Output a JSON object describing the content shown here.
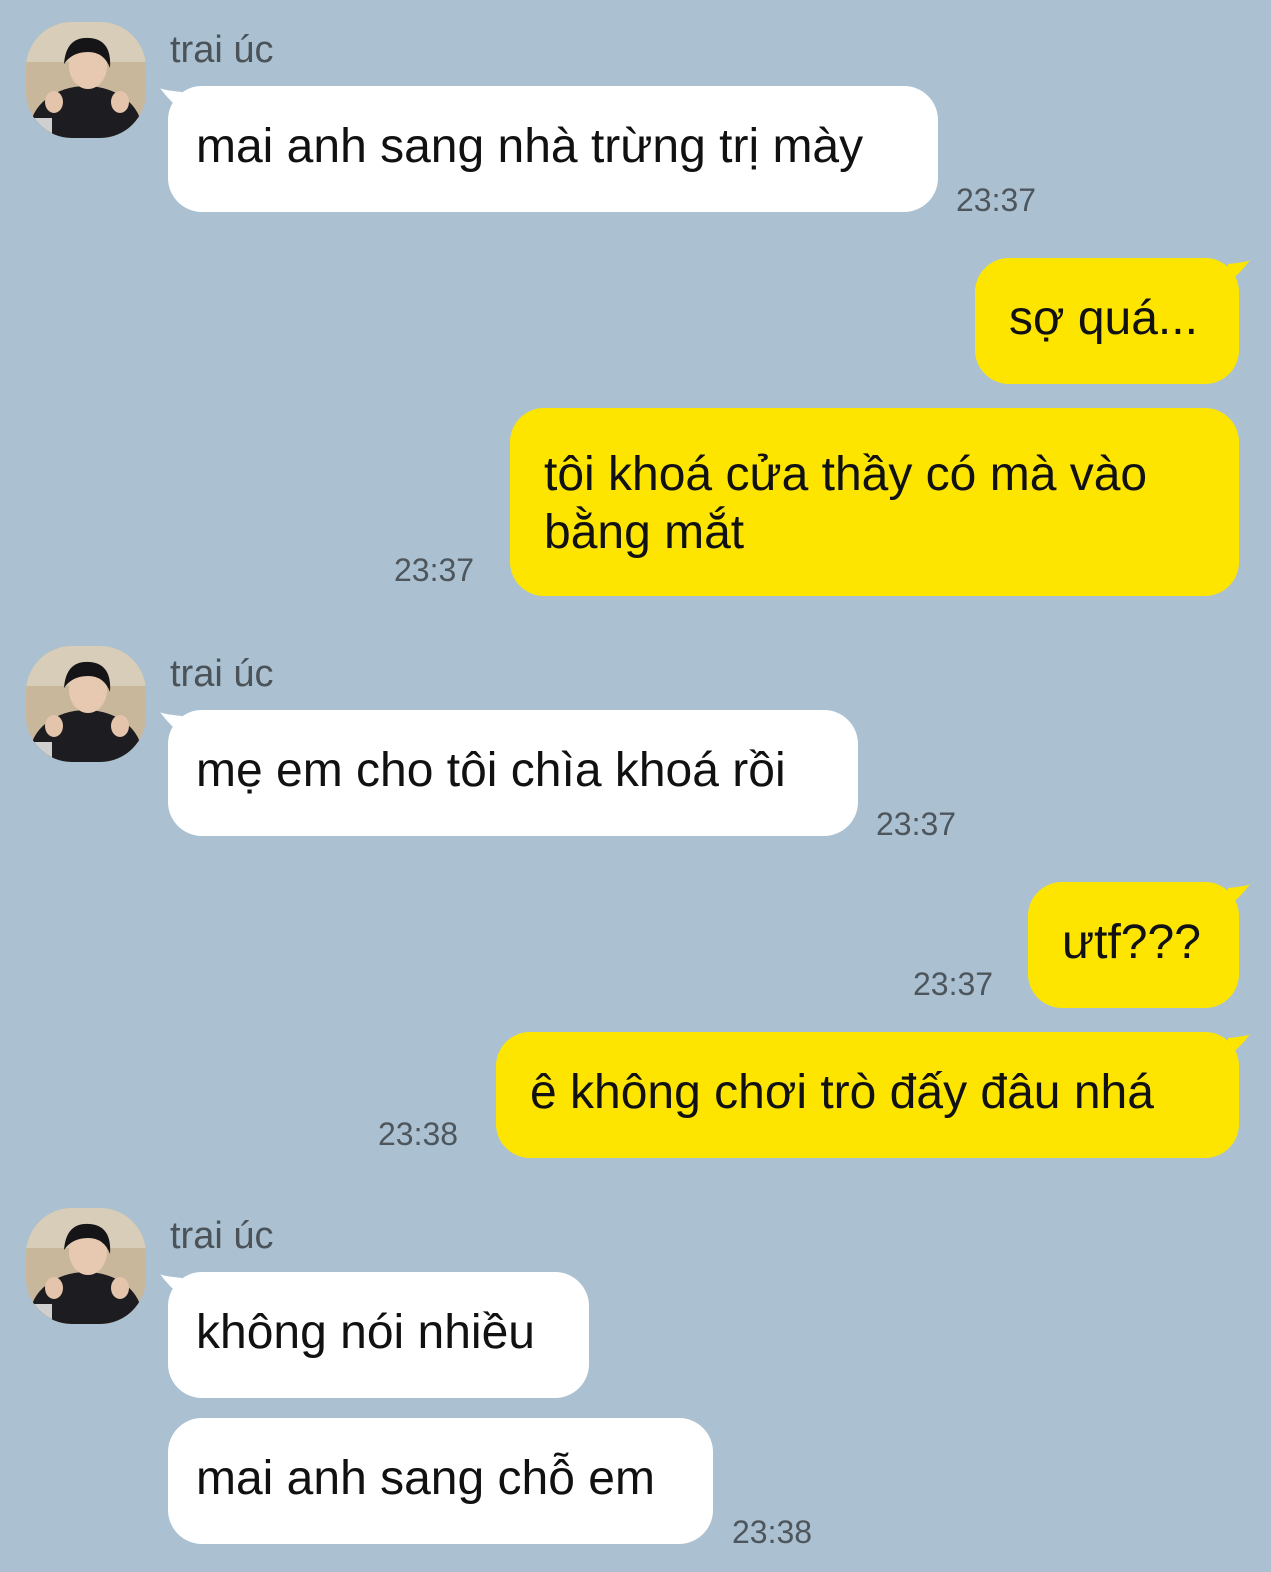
{
  "contact": {
    "name": "trai úc",
    "avatar": "profile-photo"
  },
  "colors": {
    "background": "#abc1d1",
    "incoming_bubble": "#ffffff",
    "outgoing_bubble": "#fde500"
  },
  "messages": [
    {
      "sender": "trai úc",
      "text": "mai anh sang nhà trừng trị mày",
      "time": "23:37"
    },
    {
      "sender": "me",
      "text": "sợ quá...",
      "time": ""
    },
    {
      "sender": "me",
      "text": "tôi khoá cửa thầy có mà vào bằng mắt",
      "time": "23:37"
    },
    {
      "sender": "trai úc",
      "text": "mẹ em cho tôi chìa khoá rồi",
      "time": "23:37"
    },
    {
      "sender": "me",
      "text": "ưtf???",
      "time": "23:37"
    },
    {
      "sender": "me",
      "text": "ê không chơi trò đấy đâu nhá",
      "time": "23:38"
    },
    {
      "sender": "trai úc",
      "text": "không nói nhiều",
      "time": ""
    },
    {
      "sender": "trai úc",
      "text": "mai anh sang chỗ em",
      "time": "23:38"
    }
  ]
}
